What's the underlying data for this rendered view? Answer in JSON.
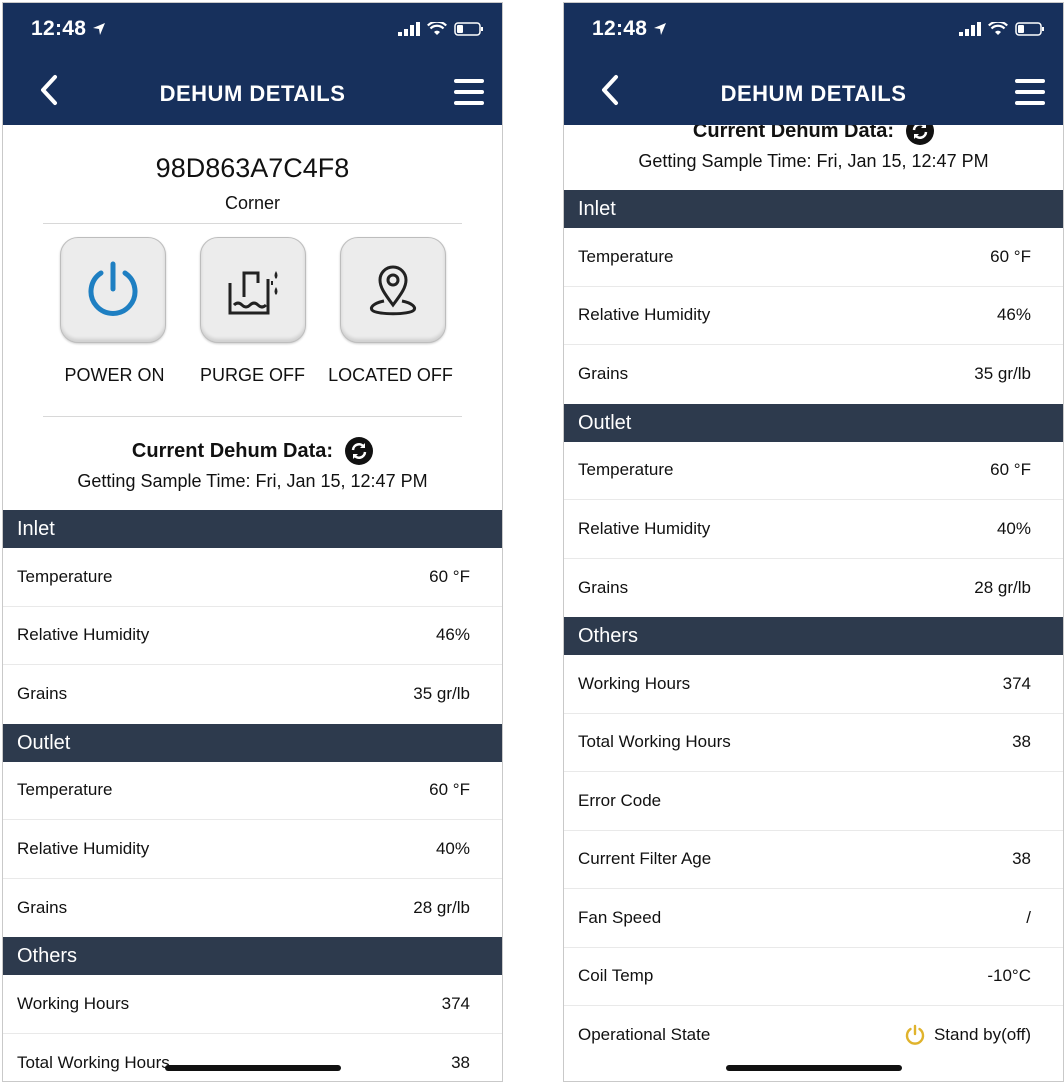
{
  "status": {
    "time": "12:48"
  },
  "nav": {
    "title": "DEHUM DETAILS"
  },
  "device": {
    "id": "98D863A7C4F8",
    "location": "Corner"
  },
  "controls": [
    {
      "label": "POWER ON",
      "icon": "power-icon",
      "color": "#1e7fc2"
    },
    {
      "label": "PURGE OFF",
      "icon": "purge-icon"
    },
    {
      "label": "LOCATED OFF",
      "icon": "location-pin-icon"
    }
  ],
  "current": {
    "title": "Current Dehum Data:",
    "sample": "Getting Sample Time: Fri, Jan 15, 12:47 PM"
  },
  "inlet": {
    "title": "Inlet",
    "rows": [
      {
        "label": "Temperature",
        "value": "60 °F"
      },
      {
        "label": "Relative Humidity",
        "value": "46%"
      },
      {
        "label": "Grains",
        "value": "35 gr/lb"
      }
    ]
  },
  "outlet": {
    "title": "Outlet",
    "rows": [
      {
        "label": "Temperature",
        "value": "60 °F"
      },
      {
        "label": "Relative Humidity",
        "value": "40%"
      },
      {
        "label": "Grains",
        "value": "28 gr/lb"
      }
    ]
  },
  "others": {
    "title": "Others",
    "rows": [
      {
        "label": "Working Hours",
        "value": "374"
      },
      {
        "label": "Total Working Hours",
        "value": "38"
      },
      {
        "label": "Error Code",
        "value": ""
      },
      {
        "label": "Current Filter Age",
        "value": "38"
      },
      {
        "label": "Fan Speed",
        "value": "/"
      },
      {
        "label": "Coil Temp",
        "value": "-10°C"
      },
      {
        "label": "Operational State",
        "value": "Stand by(off)",
        "icon": "standby-power-icon",
        "icon_color": "#e0b32c"
      }
    ]
  },
  "colors": {
    "nav": "#17305c",
    "section": "#2d3a4d",
    "power": "#1e7fc2",
    "standby": "#e0b32c"
  }
}
